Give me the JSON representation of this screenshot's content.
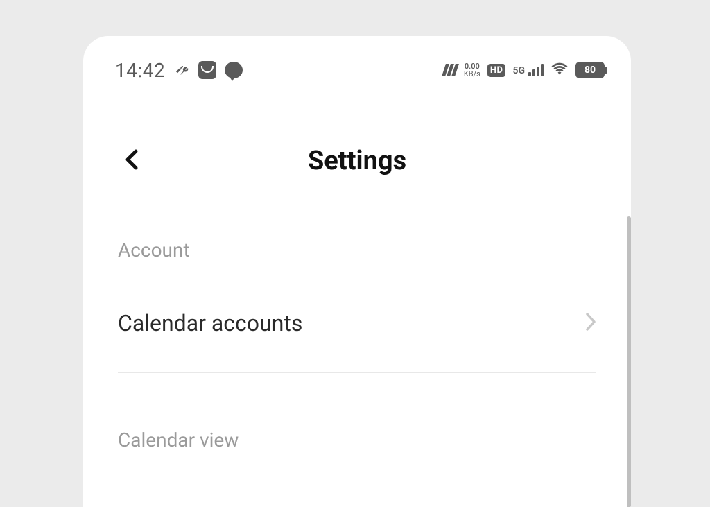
{
  "status_bar": {
    "time": "14:42",
    "network_speed_value": "0.00",
    "network_speed_unit": "KB/s",
    "hd_label": "HD",
    "network_type": "5G",
    "battery_level": "80"
  },
  "header": {
    "title": "Settings"
  },
  "sections": {
    "account": {
      "header": "Account",
      "items": {
        "calendar_accounts": {
          "label": "Calendar accounts"
        }
      }
    },
    "calendar_view": {
      "header": "Calendar view"
    }
  }
}
